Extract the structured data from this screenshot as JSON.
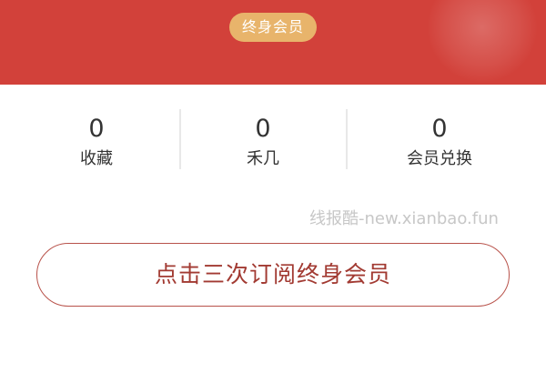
{
  "header": {
    "membership_badge": "终身会员",
    "color": "#d2413a",
    "badge_color": "#e8b46b"
  },
  "stats": [
    {
      "value": "0",
      "label": "收藏"
    },
    {
      "value": "0",
      "label": "禾几"
    },
    {
      "value": "0",
      "label": "会员兑换"
    }
  ],
  "watermark": "线报酷-new.xianbao.fun",
  "subscribe_button": {
    "label": "点击三次订阅终身会员",
    "color": "#a23a32"
  }
}
